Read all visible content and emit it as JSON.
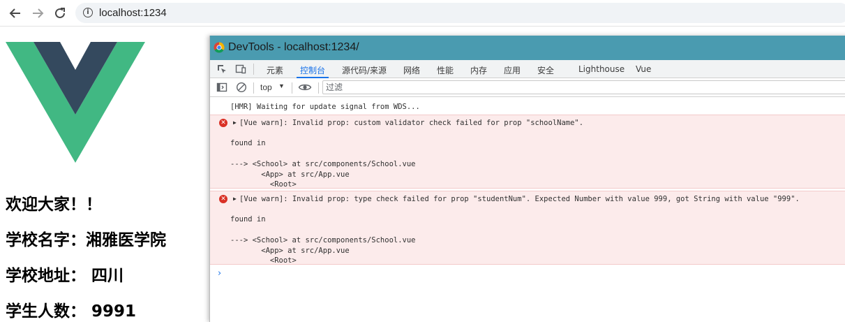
{
  "browser": {
    "url": "localhost:1234",
    "back_icon": "arrow-left-icon",
    "forward_icon": "arrow-right-icon",
    "reload_icon": "reload-icon",
    "info_icon": "info-icon"
  },
  "page": {
    "logo": "vue-logo",
    "lines": [
      "欢迎大家！！",
      "学校名字：湘雅医学院",
      "学校地址： 四川",
      "学生人数： 9991"
    ]
  },
  "devtools": {
    "title": "DevTools - localhost:1234/",
    "tabs": [
      "元素",
      "控制台",
      "源代码/来源",
      "网络",
      "性能",
      "内存",
      "应用",
      "安全",
      "Lighthouse",
      "Vue"
    ],
    "active_tab": "控制台",
    "toolbar": {
      "context": "top",
      "filter_placeholder": "过滤"
    },
    "console": {
      "log": "[HMR] Waiting for update signal from WDS...",
      "errors": [
        {
          "message": "[Vue warn]: Invalid prop: custom validator check failed for prop \"schoolName\".",
          "found": "found in",
          "trace": "---> <School> at src/components/School.vue\n       <App> at src/App.vue\n         <Root>"
        },
        {
          "message": "[Vue warn]: Invalid prop: type check failed for prop \"studentNum\". Expected Number with value 999, got String with value \"999\".",
          "found": "found in",
          "trace": "---> <School> at src/components/School.vue\n       <App> at src/App.vue\n         <Root>"
        }
      ],
      "prompt": "›"
    }
  },
  "colors": {
    "vue_green": "#41b883",
    "vue_dark": "#34495e",
    "devtools_titlebar": "#4a9bb0",
    "error_bg": "#fcebeb",
    "accent": "#1a73e8"
  }
}
